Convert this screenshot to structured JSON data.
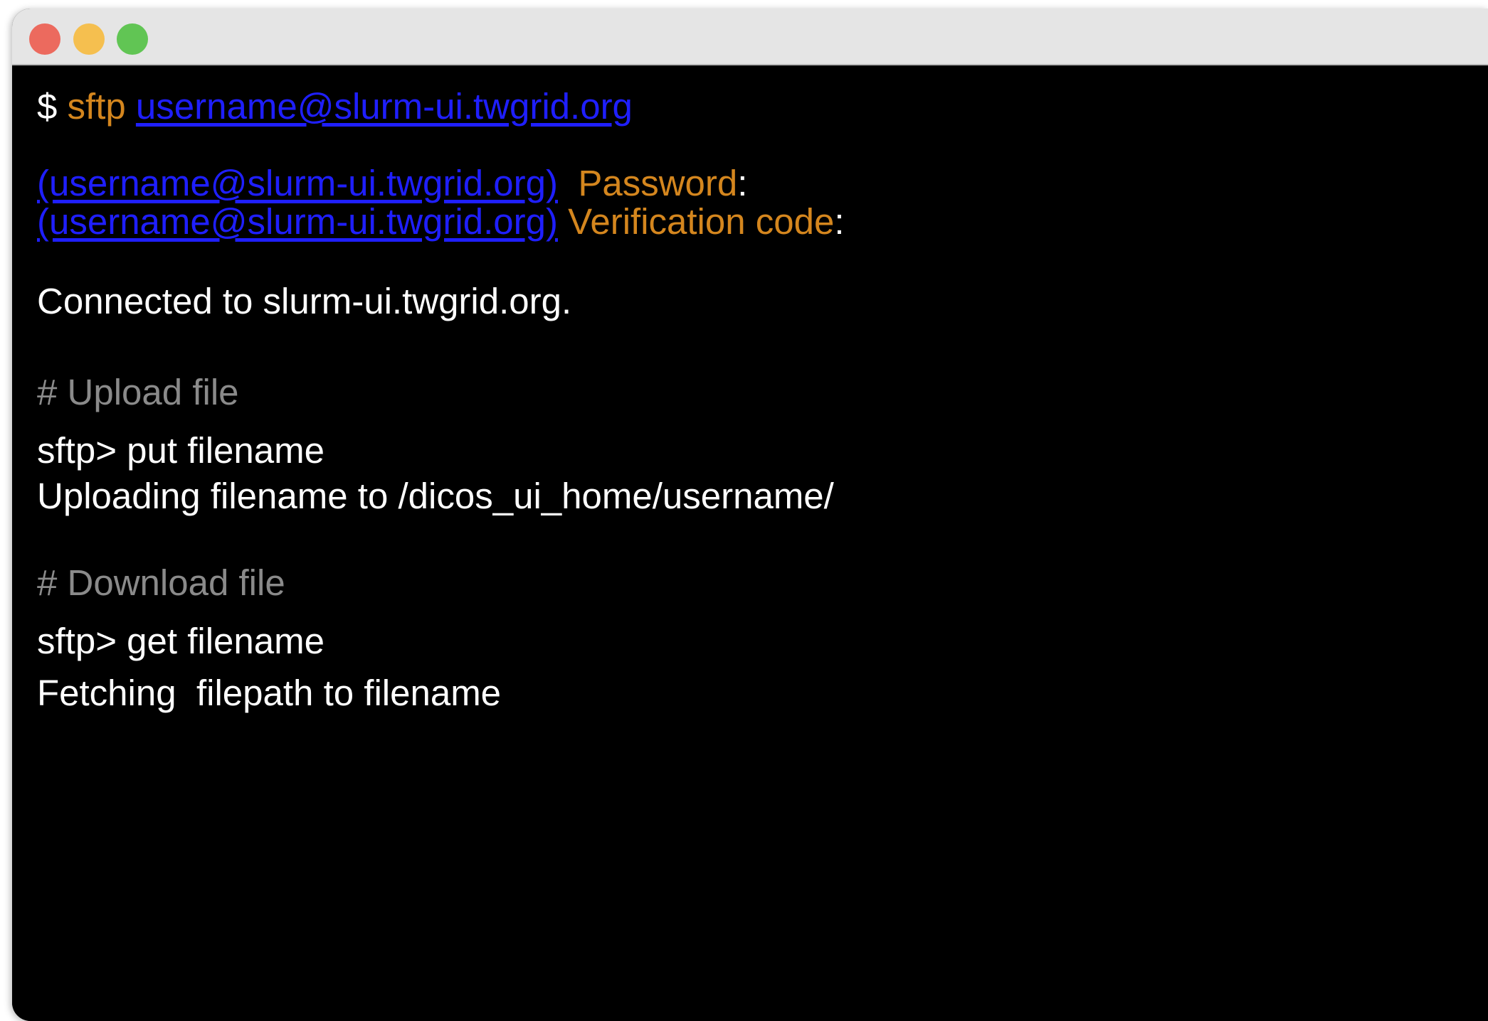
{
  "window": {
    "controls": [
      "close",
      "minimize",
      "zoom"
    ],
    "colors": {
      "close": "#ec6a5e",
      "minimize": "#f5bf4f",
      "zoom": "#61c554",
      "background": "#000000",
      "text": "#ffffff",
      "keyword": "#d4861e",
      "link": "#1f1fff",
      "comment": "#8a8a8a"
    }
  },
  "terminal": {
    "connect": {
      "prompt": "$ ",
      "command": "sftp ",
      "host": "username@slurm-ui.twgrid.org"
    },
    "password": {
      "host": "(username@slurm-ui.twgrid.org)",
      "label": "Password",
      "colon": ":"
    },
    "verification": {
      "host": "(username@slurm-ui.twgrid.org)",
      "label": "Verification code",
      "colon": ":"
    },
    "connected": "Connected to slurm-ui.twgrid.org.",
    "upload": {
      "comment": "# Upload file",
      "command": "sftp> put filename",
      "output": "Uploading filename to /dicos_ui_home/username/"
    },
    "download": {
      "comment": "# Download file",
      "command": "sftp> get filename",
      "output": "Fetching  filepath to filename"
    }
  }
}
